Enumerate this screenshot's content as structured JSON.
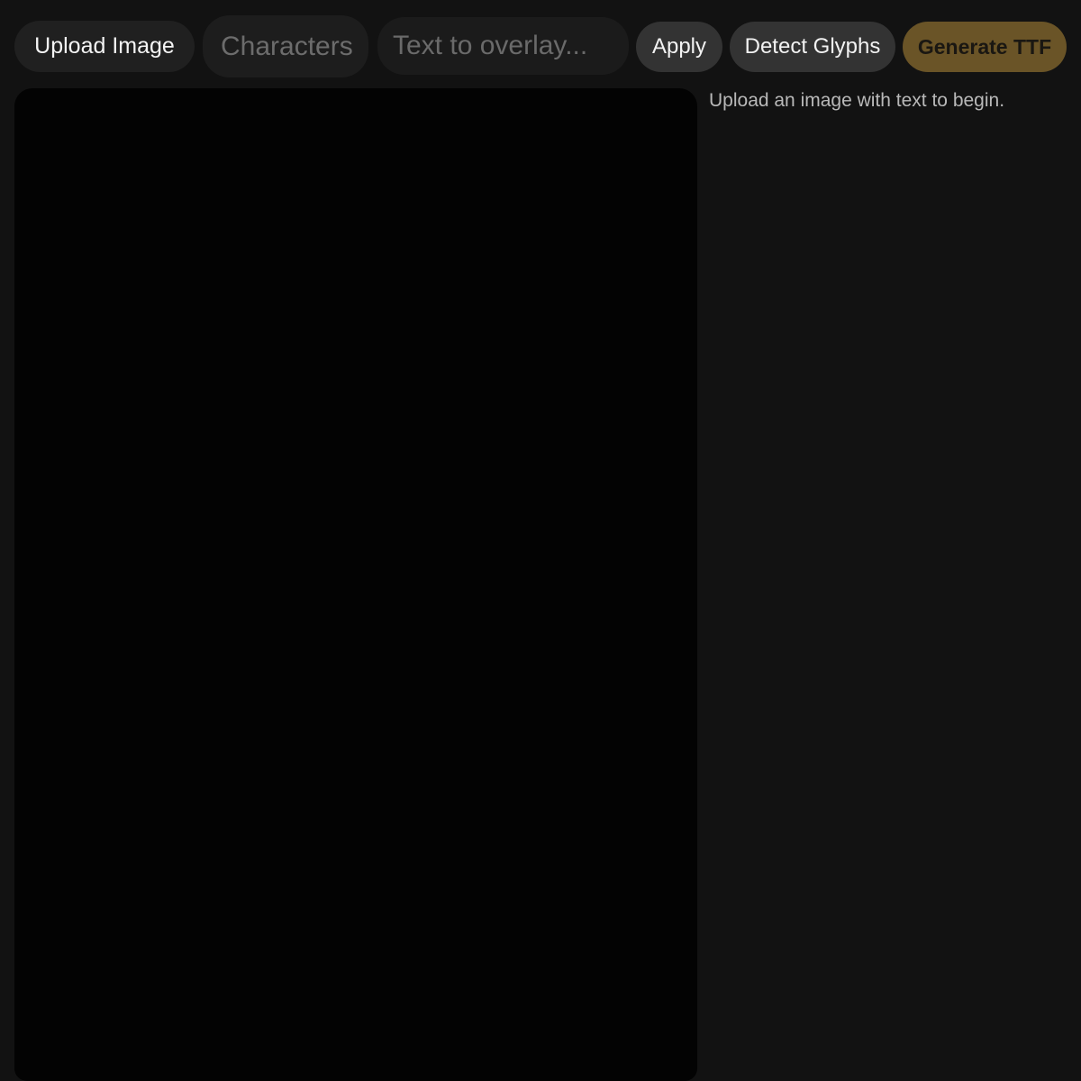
{
  "toolbar": {
    "upload_label": "Upload Image",
    "characters_placeholder": "Characters",
    "overlay_placeholder": "Text to overlay...",
    "apply_label": "Apply",
    "detect_label": "Detect Glyphs",
    "generate_label": "Generate TTF"
  },
  "side_panel": {
    "status": "Upload an image with text to begin."
  },
  "colors": {
    "background": "#121212",
    "canvas": "#030303",
    "button": "#333333",
    "accent": "#6a5427"
  }
}
